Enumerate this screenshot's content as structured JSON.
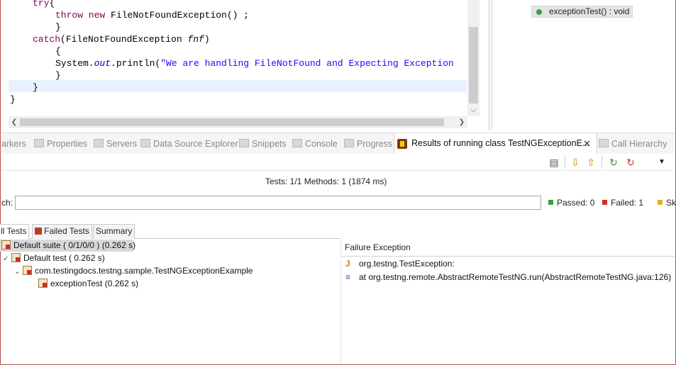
{
  "editor": {
    "lines": [
      {
        "kw": "try",
        "rest": "{",
        "indent": 2
      },
      {
        "kw": "throw new",
        "rest": " FileNotFoundException() ;",
        "indent": 4
      },
      {
        "kw": "",
        "rest": "}",
        "indent": 4
      },
      {
        "kw": "catch",
        "rest": "(FileNotFoundException ",
        "param": "fnf",
        "tail": ")",
        "indent": 2
      },
      {
        "kw": "",
        "rest": "{",
        "indent": 4
      },
      {
        "kw": "",
        "rest": "System.",
        "field": "out",
        "call": ".println(",
        "str": "\"We are handling FileNotFound and Expecting Exception",
        "indent": 4
      },
      {
        "kw": "",
        "rest": "}",
        "indent": 4
      },
      {
        "kw": "",
        "rest": "}",
        "indent": 2
      },
      {
        "kw": "",
        "rest": "}",
        "indent": 0
      }
    ]
  },
  "outline": {
    "item_label": "exceptionTest() : void"
  },
  "view_tabs": [
    {
      "label": "arkers",
      "icon": "markers-icon"
    },
    {
      "label": "Properties",
      "icon": "properties-icon"
    },
    {
      "label": "Servers",
      "icon": "servers-icon"
    },
    {
      "label": "Data Source Explorer",
      "icon": "datasource-icon"
    },
    {
      "label": "Snippets",
      "icon": "snippets-icon"
    },
    {
      "label": "Console",
      "icon": "console-icon"
    },
    {
      "label": "Progress",
      "icon": "progress-icon"
    }
  ],
  "active_tab": {
    "label": "Results of running class TestNGExceptionE...",
    "close": "✕"
  },
  "call_hierarchy_tab": "Call Hierarchy",
  "summary": {
    "text": "Tests: 1/1  Methods: 1 (1874 ms)"
  },
  "search": {
    "label": "ch:",
    "value": ""
  },
  "counters": {
    "passed": "Passed: 0",
    "failed": "Failed: 1",
    "skipped": "Sk"
  },
  "sub_tabs": {
    "all": "ll Tests",
    "failed": "Failed Tests",
    "summary": "Summary"
  },
  "tree": {
    "suite": "Default suite ( 0/1/0/0 ) (0.262 s)",
    "test": "Default test ( 0.262 s)",
    "class": "com.testingdocs.testng.sample.TestNGExceptionExample",
    "method": "exceptionTest  (0.262 s)"
  },
  "failure": {
    "title": "Failure Exception",
    "exception": "org.testng.TestException:",
    "trace": "at org.testng.remote.AbstractRemoteTestNG.run(AbstractRemoteTestNG.java:126)"
  },
  "colors": {
    "keyword": "#7f0055",
    "string": "#2a00ff",
    "passed": "#3aa043",
    "failed": "#d42a2a",
    "skipped": "#e0b020"
  }
}
